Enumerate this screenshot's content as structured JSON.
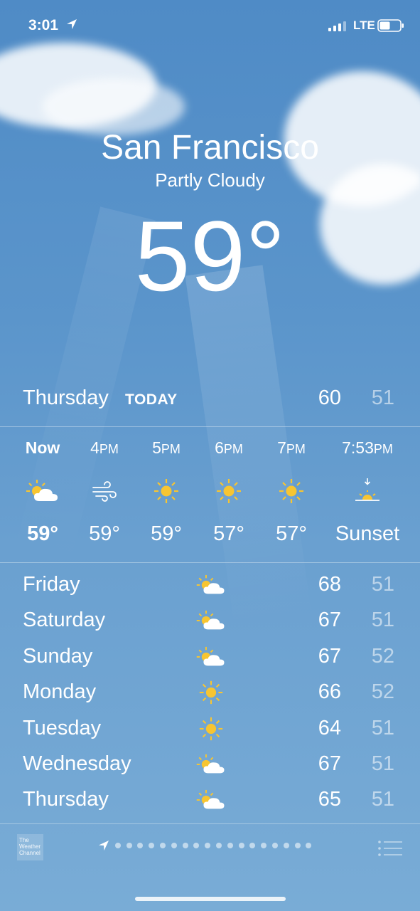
{
  "status_bar": {
    "time": "3:01",
    "network": "LTE"
  },
  "header": {
    "city": "San Francisco",
    "condition": "Partly Cloudy",
    "temperature": "59°"
  },
  "today": {
    "day": "Thursday",
    "label": "TODAY",
    "high": "60",
    "low": "51"
  },
  "hourly": [
    {
      "time": "Now",
      "ampm": "",
      "icon": "partly-cloudy-icon",
      "temp": "59°"
    },
    {
      "time": "4",
      "ampm": "PM",
      "icon": "wind-icon",
      "temp": "59°"
    },
    {
      "time": "5",
      "ampm": "PM",
      "icon": "sun-icon",
      "temp": "59°"
    },
    {
      "time": "6",
      "ampm": "PM",
      "icon": "sun-icon",
      "temp": "57°"
    },
    {
      "time": "7",
      "ampm": "PM",
      "icon": "sun-icon",
      "temp": "57°"
    },
    {
      "time": "7:53",
      "ampm": "PM",
      "icon": "sunset-icon",
      "temp": "Sunset"
    }
  ],
  "daily": [
    {
      "day": "Friday",
      "icon": "partly-cloudy-icon",
      "high": "68",
      "low": "51"
    },
    {
      "day": "Saturday",
      "icon": "partly-cloudy-icon",
      "high": "67",
      "low": "51"
    },
    {
      "day": "Sunday",
      "icon": "partly-cloudy-icon",
      "high": "67",
      "low": "52"
    },
    {
      "day": "Monday",
      "icon": "sun-icon",
      "high": "66",
      "low": "52"
    },
    {
      "day": "Tuesday",
      "icon": "sun-icon",
      "high": "64",
      "low": "51"
    },
    {
      "day": "Wednesday",
      "icon": "partly-cloudy-icon",
      "high": "67",
      "low": "51"
    },
    {
      "day": "Thursday",
      "icon": "partly-cloudy-icon",
      "high": "65",
      "low": "51"
    }
  ],
  "footer": {
    "logo_text": "The Weather Channel",
    "page_count": 19,
    "current_page": 0
  },
  "colors": {
    "sun": "#f7c531",
    "text": "#ffffff",
    "low_temp": "rgba(255,255,255,0.55)"
  }
}
